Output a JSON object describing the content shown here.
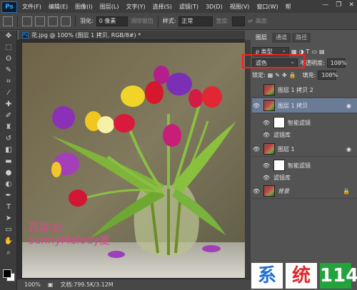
{
  "menubar": {
    "logo": "Ps",
    "items": [
      "文件(F)",
      "编辑(E)",
      "图像(I)",
      "图层(L)",
      "文字(Y)",
      "选择(S)",
      "滤镜(T)",
      "3D(D)",
      "视图(V)",
      "窗口(W)",
      "帮"
    ],
    "window_controls": [
      "—",
      "❐",
      "✕"
    ]
  },
  "options": {
    "feather_label": "羽化:",
    "feather_value": "0 像素",
    "antialias": "消除锯齿",
    "style_label": "样式:",
    "style_value": "正常",
    "width_label": "宽度:",
    "height_label": "高度:"
  },
  "document": {
    "tab_title": "花.jpg @ 100% (图层 1 拷贝, RGB/8#) *",
    "watermark_line1": "百度ID:",
    "watermark_line2": "sunnyMelody夏",
    "zoom": "100%",
    "doc_info": "文档:799.5K/3.12M"
  },
  "layers_panel": {
    "tabs": [
      "图层",
      "通道",
      "路径"
    ],
    "kind_label": "ρ 类型",
    "blend_mode": "滤色",
    "opacity_label": "不透明度:",
    "opacity_value": "100%",
    "lock_label": "锁定:",
    "fill_label": "填充:",
    "fill_value": "100%",
    "layers": [
      {
        "name": "图层 1 拷贝 2"
      },
      {
        "name": "图层 1 拷贝"
      },
      {
        "name": "图层 1"
      },
      {
        "name": "背景"
      }
    ],
    "smart_filters_label": "智能滤镜",
    "filter_name": "滤镜库"
  },
  "site_logo": [
    "系",
    "统",
    "114"
  ],
  "colors": {
    "accent_highlight": "#ff1d1d",
    "selected_layer": "#6a7b96",
    "watermark": "#d8408a"
  }
}
